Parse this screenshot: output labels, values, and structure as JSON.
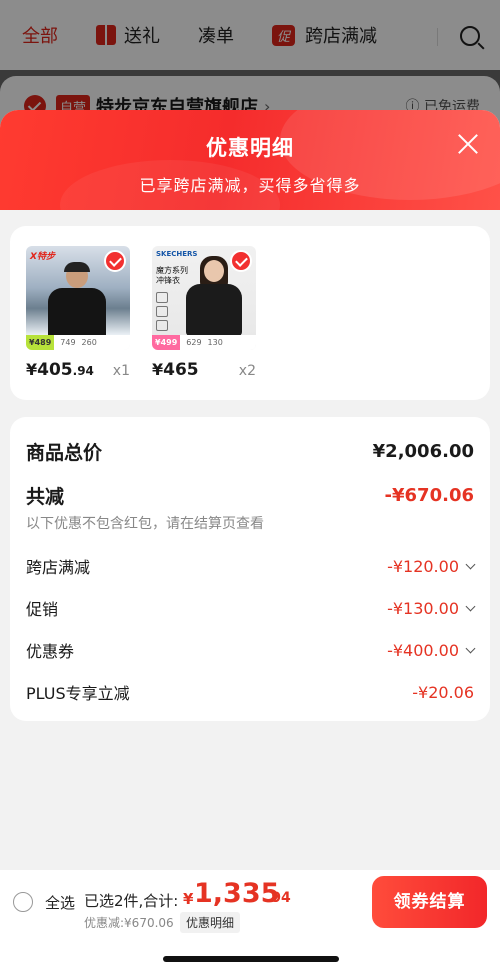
{
  "background": {
    "tabs": [
      {
        "label": "全部",
        "active": true
      },
      {
        "label": "送礼",
        "icon": "gift-icon"
      },
      {
        "label": "凑单"
      },
      {
        "label": "跨店满减",
        "badge": "促"
      }
    ],
    "shop": {
      "self_tag": "自营",
      "name": "特步京东自营旗舰店",
      "arrow": "›",
      "free_shipping": "ⓘ 已免运费"
    }
  },
  "sheet": {
    "title": "优惠明细",
    "subtitle": "已享跨店满减，买得多省得多"
  },
  "products": [
    {
      "brand": "X特步",
      "price_tag": "¥489",
      "mini_price_1": "749",
      "mini_price_2": "260",
      "currency": "¥",
      "price_int": "405",
      "price_dec": ".94",
      "qty": "x1"
    },
    {
      "brand": "SKECHERS",
      "tagline_1": "魔方系列",
      "tagline_2": "冲锋衣",
      "price_tag": "¥499",
      "mini_price_1": "629",
      "mini_price_2": "130",
      "currency": "¥",
      "price_int": "465",
      "price_dec": "",
      "qty": "x2"
    }
  ],
  "summary": {
    "total_label": "商品总价",
    "total_value": "¥2,006.00",
    "minus_label": "共减",
    "minus_value": "-¥670.06",
    "note": "以下优惠不包含红包，请在结算页查看",
    "items": [
      {
        "label": "跨店满减",
        "value": "-¥120.00",
        "expand": true
      },
      {
        "label": "促销",
        "value": "-¥130.00",
        "expand": true
      },
      {
        "label": "优惠券",
        "value": "-¥400.00",
        "expand": true
      },
      {
        "label": "PLUS专享立减",
        "value": "-¥20.06",
        "expand": false
      }
    ]
  },
  "bottom_bar": {
    "select_all": "全选",
    "chosen_text": "已选2件,合计:",
    "currency": "¥",
    "total_int": "1,335",
    "total_dec": ".94",
    "discount_text": "优惠减:¥670.06",
    "detail_button": "优惠明细",
    "checkout_button": "领券结算"
  },
  "colors": {
    "accent": "#e53323",
    "header_red": "#f52c2c"
  }
}
